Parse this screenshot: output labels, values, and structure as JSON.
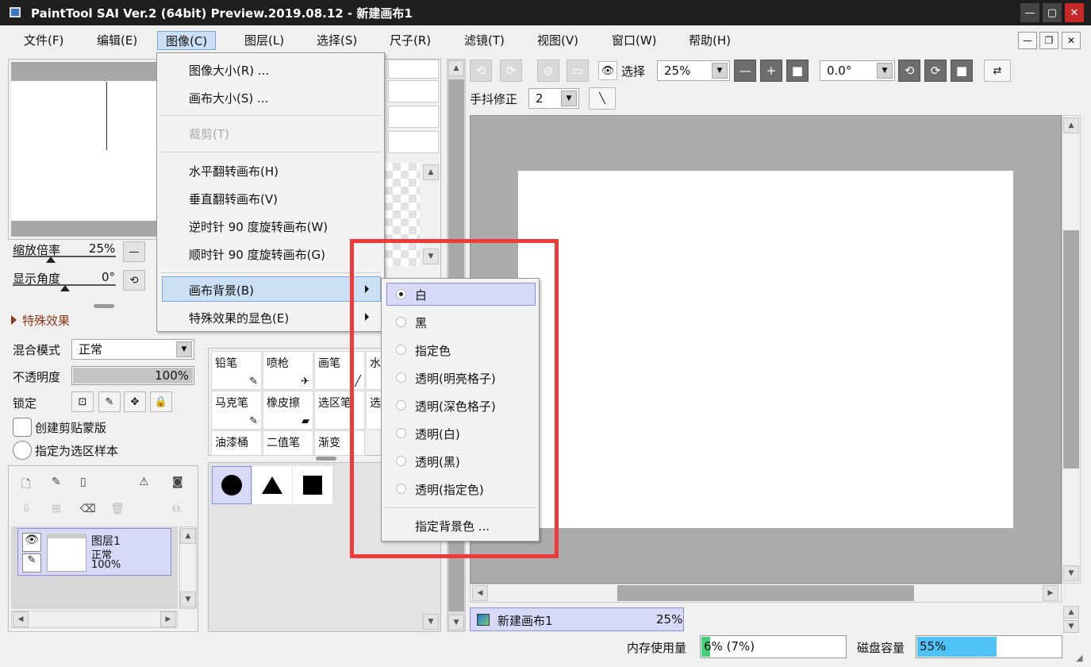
{
  "window": {
    "title": "PaintTool SAI Ver.2 (64bit) Preview.2019.08.12 - 新建画布1"
  },
  "menubar": [
    "文件(F)",
    "编辑(E)",
    "图像(C)",
    "图层(L)",
    "选择(S)",
    "尺子(R)",
    "滤镜(T)",
    "视图(V)",
    "窗口(W)",
    "帮助(H)"
  ],
  "image_menu": {
    "items": [
      "图像大小(R) ...",
      "画布大小(S) ...",
      "裁剪(T)",
      "水平翻转画布(H)",
      "垂直翻转画布(V)",
      "逆时针 90 度旋转画布(W)",
      "顺时针 90 度旋转画布(G)",
      "画布背景(B)",
      "特殊效果的显色(E)"
    ]
  },
  "bg_submenu": {
    "items": [
      "白",
      "黑",
      "指定色",
      "透明(明亮格子)",
      "透明(深色格子)",
      "透明(白)",
      "透明(黑)",
      "透明(指定色)"
    ],
    "footer": "指定背景色 ...",
    "selected": "白"
  },
  "navigator": {
    "zoom_label": "缩放倍率",
    "zoom_value": "25%",
    "angle_label": "显示角度",
    "angle_value": "0°"
  },
  "effects": {
    "label": "特殊效果"
  },
  "layer_props": {
    "blend_label": "混合模式",
    "blend_value": "正常",
    "opacity_label": "不透明度",
    "opacity_value": "100%",
    "opacity_fraction": 1.0,
    "lock_label": "锁定",
    "clip_label": "创建剪贴蒙版",
    "sample_label": "指定为选区样本"
  },
  "layers": [
    {
      "name": "图层1",
      "mode": "正常",
      "opacity": "100%"
    }
  ],
  "tools": [
    "铅笔",
    "喷枪",
    "画笔",
    "水",
    "马克笔",
    "橡皮擦",
    "选区笔",
    "选",
    "油漆桶",
    "二值笔",
    "渐变"
  ],
  "toolbar": {
    "select_label": "选择",
    "zoom": "25%",
    "angle": "0.0°",
    "stabilizer_label": "手抖修正",
    "stabilizer": "2"
  },
  "canvas_tab": {
    "name": "新建画布1",
    "zoom": "25%"
  },
  "status": {
    "memory_label": "内存使用量",
    "memory_value": "6% (7%)",
    "memory_fraction": 0.06,
    "disk_label": "磁盘容量",
    "disk_value": "55%",
    "disk_fraction": 0.55
  },
  "colors": {
    "highlight": "#d8d8f8",
    "annotation_red": "#f03a3a",
    "disk_bar": "#4fc3f7",
    "memory_bar": "#3fd27a"
  }
}
